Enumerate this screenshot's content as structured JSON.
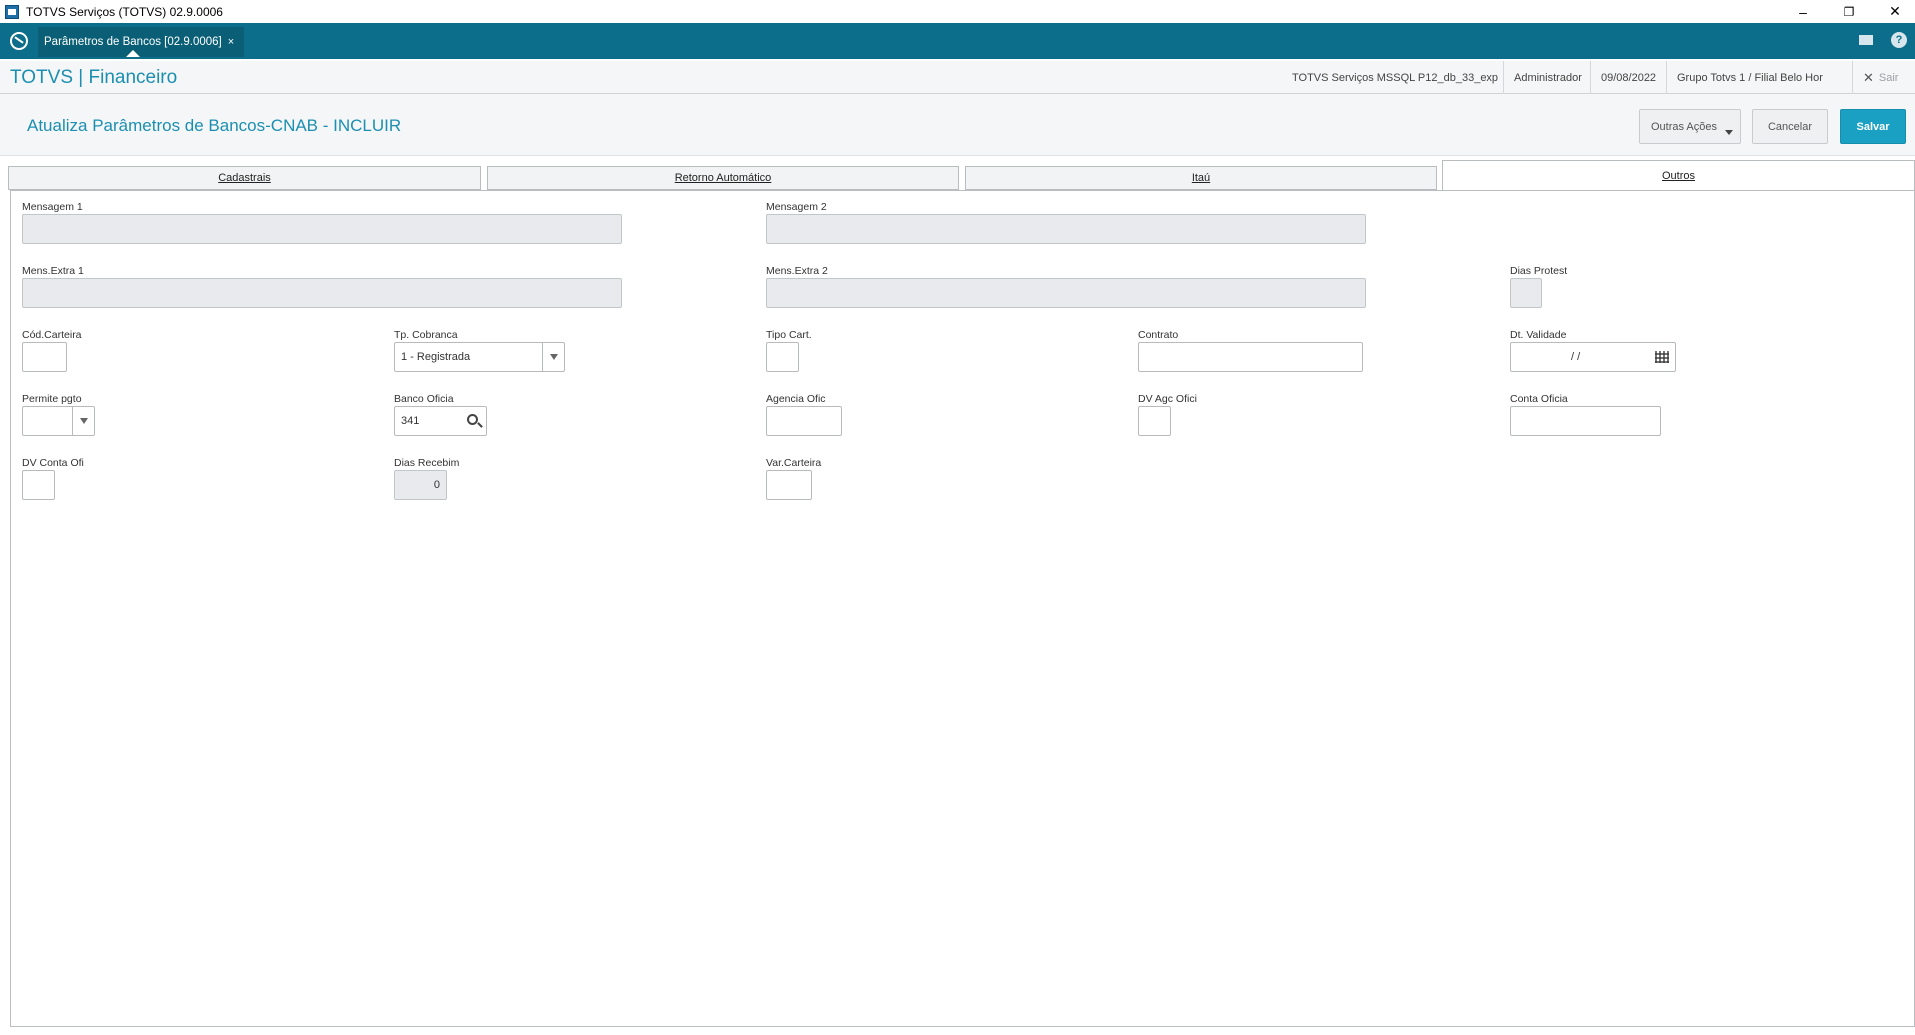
{
  "window": {
    "title": "TOTVS Serviços (TOTVS) 02.9.0006",
    "minimize": "–",
    "restore": "❐",
    "close": "✕"
  },
  "tabbar": {
    "tab_label": "Parâmetros de Bancos [02.9.0006]",
    "tab_close": "×",
    "help": "?"
  },
  "appheader": {
    "brand": "TOTVS | Financeiro",
    "environment": "TOTVS Serviços MSSQL P12_db_33_exp",
    "user": "Administrador",
    "date": "09/08/2022",
    "branch": "Grupo Totvs 1 / Filial Belo Hor",
    "exit": "Sair"
  },
  "page": {
    "title": "Atualiza Parâmetros de Bancos-CNAB - INCLUIR",
    "buttons": {
      "other_actions": "Outras Ações",
      "cancel": "Cancelar",
      "save": "Salvar"
    }
  },
  "folders": [
    "Cadastrais",
    "Retorno Automático",
    "Itaú",
    "Outros"
  ],
  "fields": {
    "mensagem1": {
      "label": "Mensagem 1",
      "value": ""
    },
    "mensagem2": {
      "label": "Mensagem 2",
      "value": ""
    },
    "mens_extra1": {
      "label": "Mens.Extra 1",
      "value": ""
    },
    "mens_extra2": {
      "label": "Mens.Extra 2",
      "value": ""
    },
    "dias_protest": {
      "label": "Dias Protest",
      "value": ""
    },
    "cod_carteira": {
      "label": "Cód.Carteira",
      "value": ""
    },
    "tp_cobranca": {
      "label": "Tp. Cobranca",
      "value": "1 - Registrada"
    },
    "tipo_cart": {
      "label": "Tipo Cart.",
      "value": ""
    },
    "contrato": {
      "label": "Contrato",
      "value": ""
    },
    "dt_validade": {
      "label": "Dt. Validade",
      "value": "/ /"
    },
    "permite_pgto": {
      "label": "Permite pgto",
      "value": ""
    },
    "banco_oficia": {
      "label": "Banco Oficia",
      "value": "341"
    },
    "agencia_ofic": {
      "label": "Agencia Ofic",
      "value": ""
    },
    "dv_agc_ofici": {
      "label": "DV Agc Ofici",
      "value": ""
    },
    "conta_oficia": {
      "label": "Conta Oficia",
      "value": ""
    },
    "dv_conta_ofi": {
      "label": "DV Conta Ofi",
      "value": ""
    },
    "dias_recebim": {
      "label": "Dias Recebim",
      "value": "0"
    },
    "var_carteira": {
      "label": "Var.Carteira",
      "value": ""
    }
  }
}
